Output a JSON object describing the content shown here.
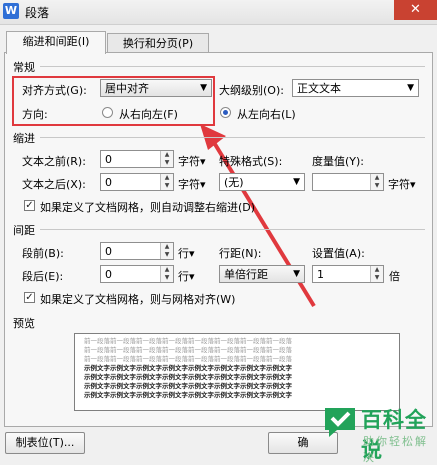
{
  "window": {
    "title": "段落",
    "app_logo": "W",
    "close_glyph": "✕"
  },
  "tabs": [
    {
      "label": "缩进和间距(I)",
      "active": true
    },
    {
      "label": "换行和分页(P)",
      "active": false
    }
  ],
  "general": {
    "section": "常规",
    "align_label": "对齐方式(G):",
    "align_value": "居中对齐",
    "outline_label": "大纲级别(O):",
    "outline_value": "正文文本",
    "direction_label": "方向:",
    "rtl_label": "从右向左(F)",
    "ltr_label": "从左向右(L)"
  },
  "indent": {
    "section": "缩进",
    "before_label": "文本之前(R):",
    "before_value": "0",
    "after_label": "文本之后(X):",
    "after_value": "0",
    "unit": "字符▾",
    "special_label": "特殊格式(S):",
    "special_value": "(无)",
    "measure_label": "度量值(Y):",
    "measure_unit": "字符▾",
    "grid_check_label": "如果定义了文档网格，则自动调整右缩进(D)"
  },
  "spacing": {
    "section": "间距",
    "before_label": "段前(B):",
    "before_value": "0",
    "after_label": "段后(E):",
    "after_value": "0",
    "unit": "行▾",
    "line_label": "行距(N):",
    "line_value": "单倍行距",
    "setting_label": "设置值(A):",
    "setting_value": "1",
    "setting_unit": "倍",
    "grid_check_label": "如果定义了文档网格，则与网格对齐(W)"
  },
  "preview": {
    "section": "预览",
    "lines": [
      "前一段落前一段落前一段落前一段落前一段落前一段落前一段落前一段落",
      "前一段落前一段落前一段落前一段落前一段落前一段落前一段落前一段落",
      "前一段落前一段落前一段落前一段落前一段落前一段落前一段落前一段落",
      "示例文字示例文字示例文字示例文字示例文字示例文字示例文字示例文字",
      "示例文字示例文字示例文字示例文字示例文字示例文字示例文字示例文字",
      "示例文字示例文字示例文字示例文字示例文字示例文字示例文字示例文字",
      "示例文字示例文字示例文字示例文字示例文字示例文字示例文字示例文字"
    ]
  },
  "footer": {
    "tabs_button": "制表位(T)...",
    "ok_button": "确"
  },
  "watermark": {
    "brand": "百科全说",
    "slogan": "助你轻松解决"
  },
  "colors": {
    "highlight": "#e0393e",
    "accent": "#2a5bc0",
    "close": "#c94231",
    "watermark": "#22a35a"
  }
}
